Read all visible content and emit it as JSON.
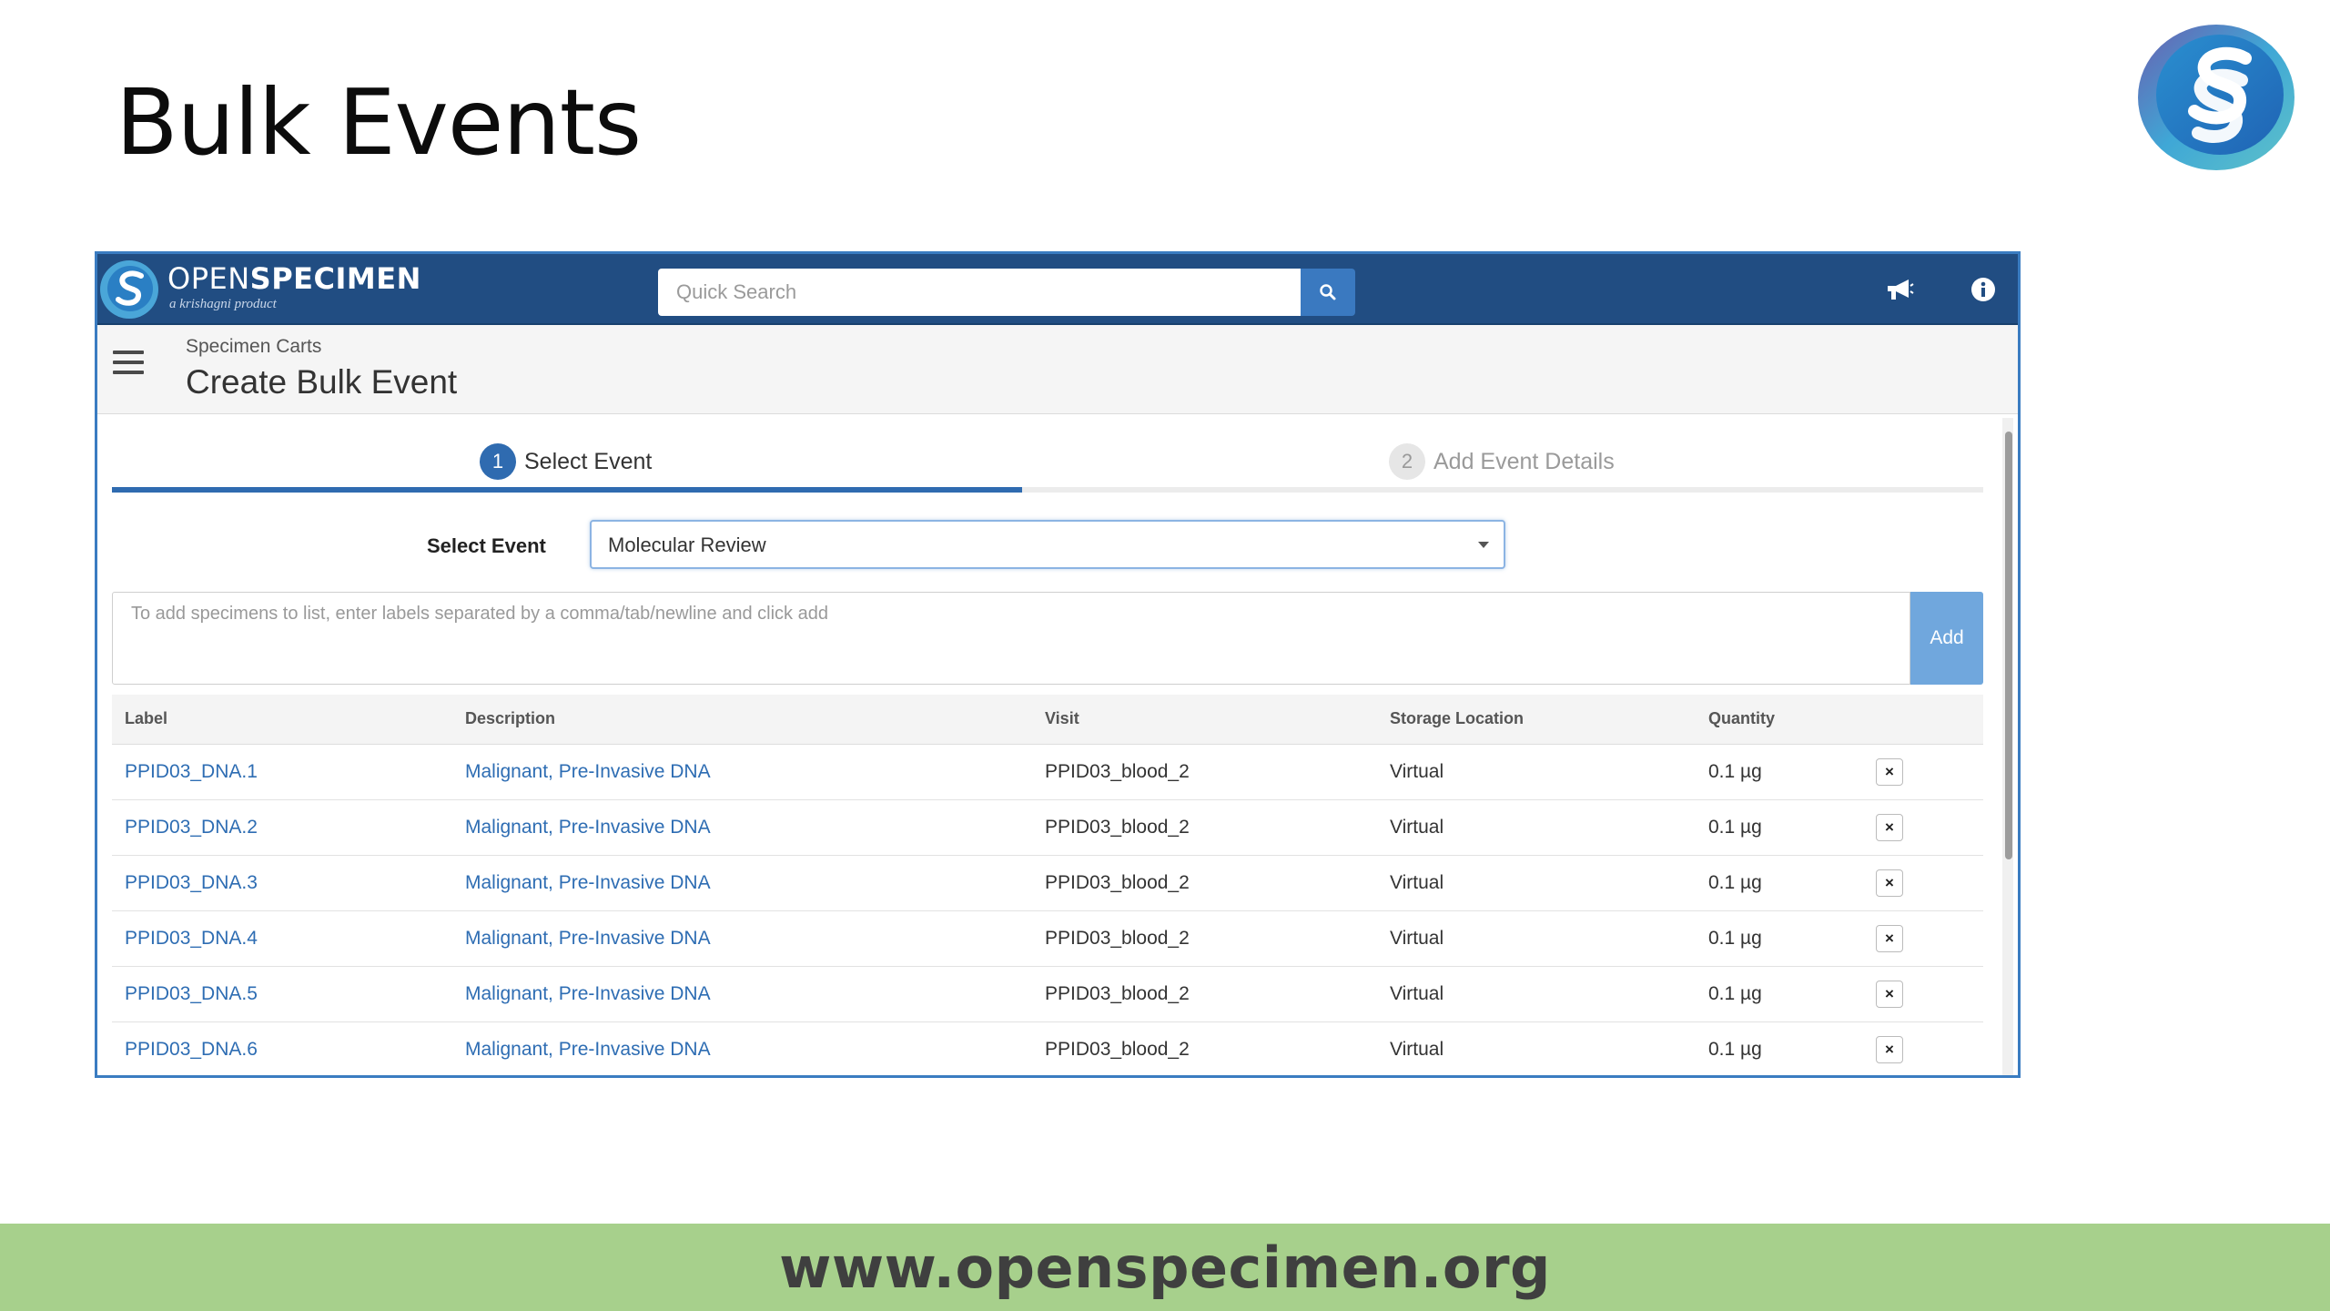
{
  "slide": {
    "title": "Bulk Events",
    "footer_url": "www.openspecimen.org"
  },
  "app": {
    "brand": {
      "name_part1": "OPEN",
      "name_part2": "SPECIMEN",
      "tagline": "a krishagni product"
    },
    "search": {
      "placeholder": "Quick Search"
    },
    "breadcrumb": "Specimen Carts",
    "page_title": "Create Bulk Event",
    "wizard": {
      "steps": [
        {
          "number": "1",
          "label": "Select Event",
          "active": true
        },
        {
          "number": "2",
          "label": "Add Event Details",
          "active": false
        }
      ]
    },
    "select_event": {
      "label": "Select Event",
      "value": "Molecular Review"
    },
    "add_specimens": {
      "placeholder": "To add specimens to list, enter labels separated by a comma/tab/newline and click add",
      "button_label": "Add"
    },
    "table": {
      "columns": [
        "Label",
        "Description",
        "Visit",
        "Storage Location",
        "Quantity"
      ],
      "rows": [
        {
          "label": "PPID03_DNA.1",
          "description": "Malignant, Pre-Invasive DNA",
          "visit": "PPID03_blood_2",
          "storage": "Virtual",
          "quantity": "0.1 µg",
          "remove": "×"
        },
        {
          "label": "PPID03_DNA.2",
          "description": "Malignant, Pre-Invasive DNA",
          "visit": "PPID03_blood_2",
          "storage": "Virtual",
          "quantity": "0.1 µg",
          "remove": "×"
        },
        {
          "label": "PPID03_DNA.3",
          "description": "Malignant, Pre-Invasive DNA",
          "visit": "PPID03_blood_2",
          "storage": "Virtual",
          "quantity": "0.1 µg",
          "remove": "×"
        },
        {
          "label": "PPID03_DNA.4",
          "description": "Malignant, Pre-Invasive DNA",
          "visit": "PPID03_blood_2",
          "storage": "Virtual",
          "quantity": "0.1 µg",
          "remove": "×"
        },
        {
          "label": "PPID03_DNA.5",
          "description": "Malignant, Pre-Invasive DNA",
          "visit": "PPID03_blood_2",
          "storage": "Virtual",
          "quantity": "0.1 µg",
          "remove": "×"
        },
        {
          "label": "PPID03_DNA.6",
          "description": "Malignant, Pre-Invasive DNA",
          "visit": "PPID03_blood_2",
          "storage": "Virtual",
          "quantity": "0.1 µg",
          "remove": "×"
        }
      ]
    },
    "icons": {
      "brand": "openspecimen-logo-icon",
      "search": "search-icon",
      "announcements": "megaphone-icon",
      "info": "info-icon",
      "user": "user-icon",
      "menu": "hamburger-menu-icon",
      "dropdown": "chevron-down-icon",
      "remove": "close-icon"
    },
    "colors": {
      "navbar": "#214d82",
      "accent": "#2f6bb0",
      "link": "#2e6db3",
      "add_button": "#70a7dd",
      "footer_band": "#a7d08c"
    }
  }
}
